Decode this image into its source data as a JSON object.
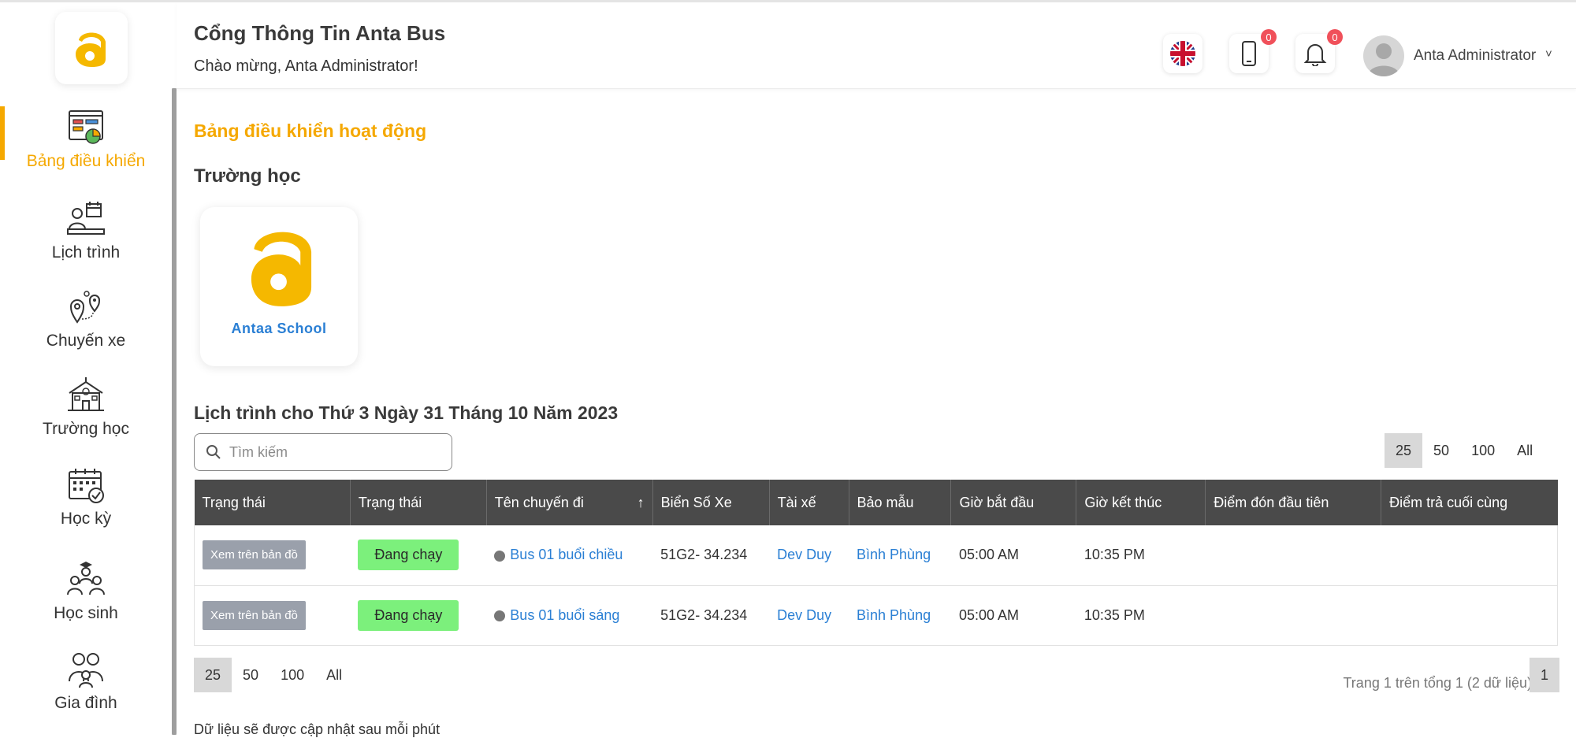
{
  "header": {
    "title": "Cổng Thông Tin Anta Bus",
    "welcome": "Chào mừng, Anta Administrator!",
    "phone_badge": "0",
    "bell_badge": "0",
    "user_name": "Anta Administrator",
    "caret": "˅"
  },
  "sidebar": {
    "items": [
      {
        "label": "Bảng điều khiển",
        "icon": "dashboard-icon",
        "active": true
      },
      {
        "label": "Lịch trình",
        "icon": "schedule-icon"
      },
      {
        "label": "Chuyến xe",
        "icon": "route-icon"
      },
      {
        "label": "Trường học",
        "icon": "school-icon"
      },
      {
        "label": "Học kỳ",
        "icon": "calendar-icon"
      },
      {
        "label": "Học sinh",
        "icon": "students-icon"
      },
      {
        "label": "Gia đình",
        "icon": "family-icon"
      }
    ]
  },
  "main": {
    "page_title": "Bảng điều khiển hoạt động",
    "section_title": "Trường học",
    "school_name": "Antaa  School",
    "schedule_title": "Lịch trình cho Thứ 3 Ngày 31 Tháng 10 Năm 2023",
    "search_placeholder": "Tìm kiếm",
    "page_sizes": [
      "25",
      "50",
      "100",
      "All"
    ],
    "columns": [
      "Trạng thái",
      "Trạng thái",
      "Tên chuyến đi",
      "Biển Số Xe",
      "Tài xế",
      "Bảo mẫu",
      "Giờ bắt đầu",
      "Giờ kết thúc",
      "Điểm đón đầu tiên",
      "Điểm trả cuối cùng"
    ],
    "sort_arrow": "↑",
    "rows": [
      {
        "map": "Xem trên bản đồ",
        "status": "Đang chạy",
        "trip": "Bus 01 buổi chiều",
        "plate": "51G2- 34.234",
        "driver": "Dev Duy",
        "nanny": "Bình Phùng",
        "start": "05:00 AM",
        "end": "10:35 PM",
        "first": "",
        "last": ""
      },
      {
        "map": "Xem trên bản đồ",
        "status": "Đang chạy",
        "trip": "Bus 01 buổi sáng",
        "plate": "51G2- 34.234",
        "driver": "Dev Duy",
        "nanny": "Bình Phùng",
        "start": "05:00 AM",
        "end": "10:35 PM",
        "first": "",
        "last": ""
      }
    ],
    "footer_info": "Trang 1 trên tổng 1 (2 dữ liệu)",
    "current_page": "1",
    "update_note": "Dữ liệu sẽ được cập nhật sau mỗi phút"
  },
  "colors": {
    "accent": "#f5a800",
    "link": "#2a7fd4",
    "status_green": "#7cf07c",
    "header_dark": "#4a4a4a"
  }
}
